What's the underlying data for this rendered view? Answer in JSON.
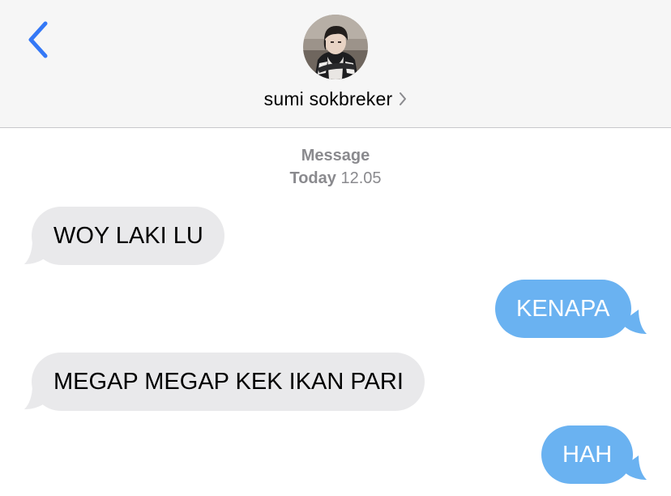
{
  "header": {
    "back_icon": "chevron-left-icon",
    "contact_name": "sumi sokbreker",
    "contact_chevron": "chevron-right-icon",
    "accent_color": "#3478f6"
  },
  "thread": {
    "service_label": "Message",
    "day": "Today",
    "time": "12.05"
  },
  "messages": [
    {
      "direction": "incoming",
      "text": "WOY LAKI LU"
    },
    {
      "direction": "outgoing",
      "text": "KENAPA"
    },
    {
      "direction": "incoming",
      "text": "MEGAP MEGAP KEK IKAN PARI"
    },
    {
      "direction": "outgoing",
      "text": "HAH"
    }
  ],
  "colors": {
    "incoming_bubble": "#e9e9eb",
    "outgoing_bubble": "#6ab2f1",
    "meta_text": "#8a8a8e",
    "header_bg": "#f6f6f6"
  }
}
